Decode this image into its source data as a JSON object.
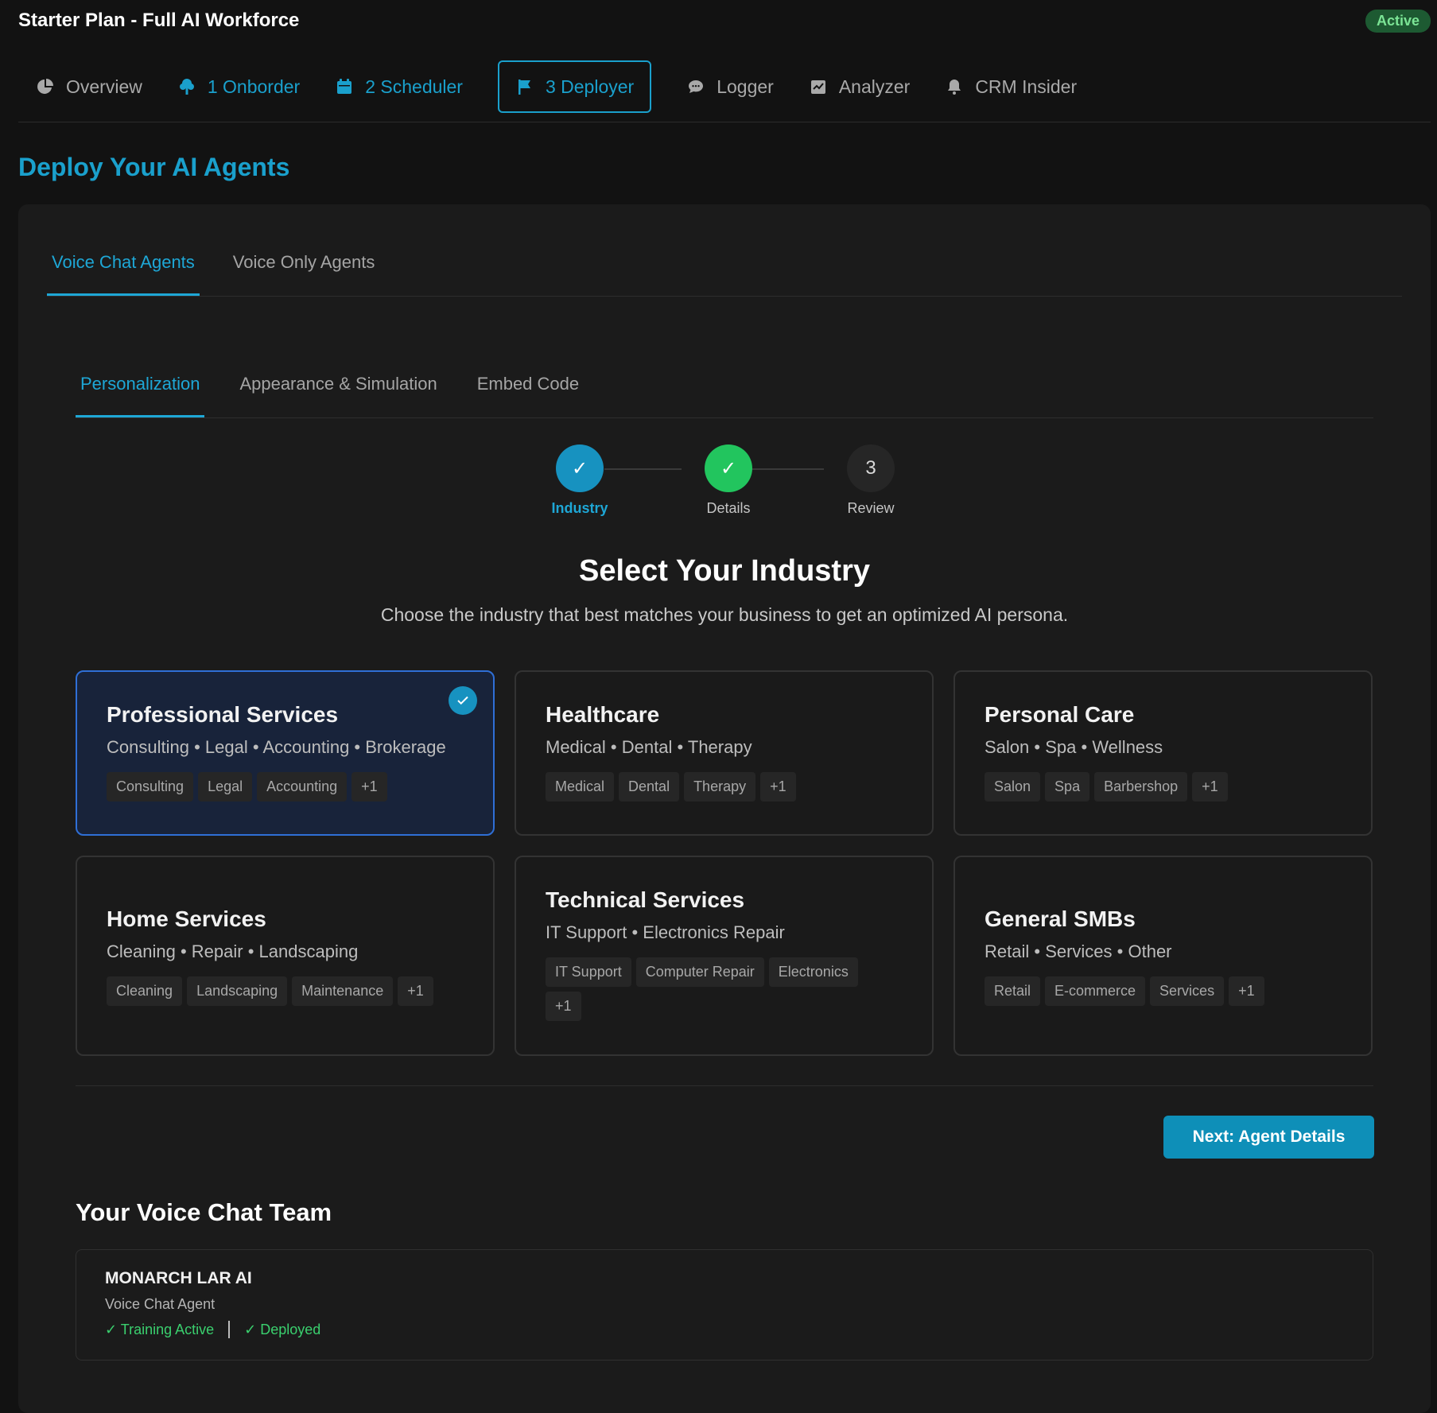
{
  "header": {
    "plan_title": "Starter Plan - Full AI Workforce",
    "status_badge": "Active"
  },
  "nav": {
    "items": [
      {
        "label": "Overview",
        "icon": "pie-chart-icon"
      },
      {
        "label": "1 Onborder",
        "icon": "tree-icon"
      },
      {
        "label": "2 Scheduler",
        "icon": "calendar-icon"
      },
      {
        "label": "3 Deployer",
        "icon": "flag-icon"
      },
      {
        "label": "Logger",
        "icon": "chat-icon"
      },
      {
        "label": "Analyzer",
        "icon": "check-chart-icon"
      },
      {
        "label": "CRM Insider",
        "icon": "bell-icon"
      }
    ],
    "active_index": 3
  },
  "page": {
    "title": "Deploy Your AI Agents"
  },
  "agent_tabs": [
    "Voice Chat Agents",
    "Voice Only Agents"
  ],
  "sub_tabs": [
    "Personalization",
    "Appearance & Simulation",
    "Embed Code"
  ],
  "stepper": {
    "steps": [
      {
        "symbol": "✓",
        "label": "Industry",
        "state": "current"
      },
      {
        "symbol": "✓",
        "label": "Details",
        "state": "completed"
      },
      {
        "symbol": "3",
        "label": "Review",
        "state": "pending"
      }
    ]
  },
  "industry": {
    "title": "Select Your Industry",
    "subtitle": "Choose the industry that best matches your business to get an optimized AI persona.",
    "cards": [
      {
        "title": "Professional Services",
        "desc": [
          "Consulting",
          "Legal",
          "Accounting",
          "Brokerage"
        ],
        "tags": [
          "Consulting",
          "Legal",
          "Accounting",
          "+1"
        ],
        "selected": true
      },
      {
        "title": "Healthcare",
        "desc": [
          "Medical",
          "Dental",
          "Therapy"
        ],
        "tags": [
          "Medical",
          "Dental",
          "Therapy",
          "+1"
        ],
        "selected": false
      },
      {
        "title": "Personal Care",
        "desc": [
          "Salon",
          "Spa",
          "Wellness"
        ],
        "tags": [
          "Salon",
          "Spa",
          "Barbershop",
          "+1"
        ],
        "selected": false
      },
      {
        "title": "Home Services",
        "desc": [
          "Cleaning",
          "Repair",
          "Landscaping"
        ],
        "tags": [
          "Cleaning",
          "Landscaping",
          "Maintenance",
          "+1"
        ],
        "selected": false
      },
      {
        "title": "Technical Services",
        "desc": [
          "IT Support",
          "Electronics Repair"
        ],
        "tags": [
          "IT Support",
          "Computer Repair",
          "Electronics",
          "+1"
        ],
        "selected": false
      },
      {
        "title": "General SMBs",
        "desc": [
          "Retail",
          "Services",
          "Other"
        ],
        "tags": [
          "Retail",
          "E-commerce",
          "Services",
          "+1"
        ],
        "selected": false
      }
    ],
    "next_button": "Next: Agent Details"
  },
  "team": {
    "title": "Your Voice Chat Team",
    "agent": {
      "name": "MONARCH LAR AI",
      "type": "Voice Chat Agent",
      "status_training": "✓ Training Active",
      "status_deployed": "✓ Deployed"
    }
  },
  "colors": {
    "accent": "#1aa0cc",
    "success": "#22c55e",
    "selected_border": "#2f6fd6",
    "background": "#121212"
  }
}
